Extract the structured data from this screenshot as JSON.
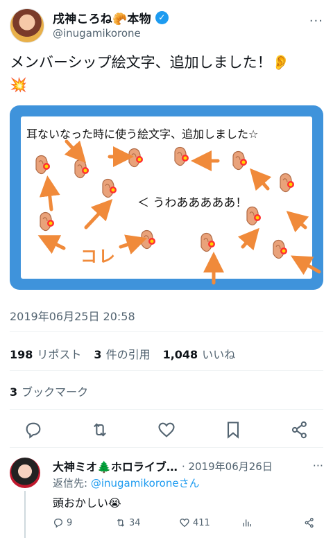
{
  "author": {
    "name": "戌神ころね🥐本物",
    "handle": "@inugamikorone",
    "verified_icon": "✓"
  },
  "tweet": {
    "line1": "メンバーシップ絵文字、追加しました！👂",
    "line2": "💥"
  },
  "media": {
    "caption": "耳ないなった時に使う絵文字、追加しました☆",
    "shout": "＜ うわあああああ！",
    "kore": "コレ"
  },
  "timestamp": "2019年06月25日 20:58",
  "stats": {
    "reposts_count": "198",
    "reposts_label": "リポスト",
    "quotes_count": "3",
    "quotes_label": "件の引用",
    "likes_count": "1,048",
    "likes_label": "いいね"
  },
  "bookmarks": {
    "count": "3",
    "label": "ブックマーク"
  },
  "reply": {
    "name": "大神ミオ🌲ホロライブ…",
    "date": "· 2019年06月26日",
    "to_prefix": "返信先: ",
    "to_handle": "@inugamikorone",
    "to_suffix": "さん",
    "text": "頭おかしい😭",
    "replies": "9",
    "reposts": "34",
    "likes": "411"
  },
  "colors": {
    "accent": "#1d9bf0",
    "media_frame": "#3f93db",
    "arrow": "#f08a3a"
  },
  "icons": [
    "verified-icon",
    "more-icon",
    "reply-icon",
    "repost-icon",
    "like-icon",
    "bookmark-icon",
    "share-icon",
    "views-icon"
  ]
}
